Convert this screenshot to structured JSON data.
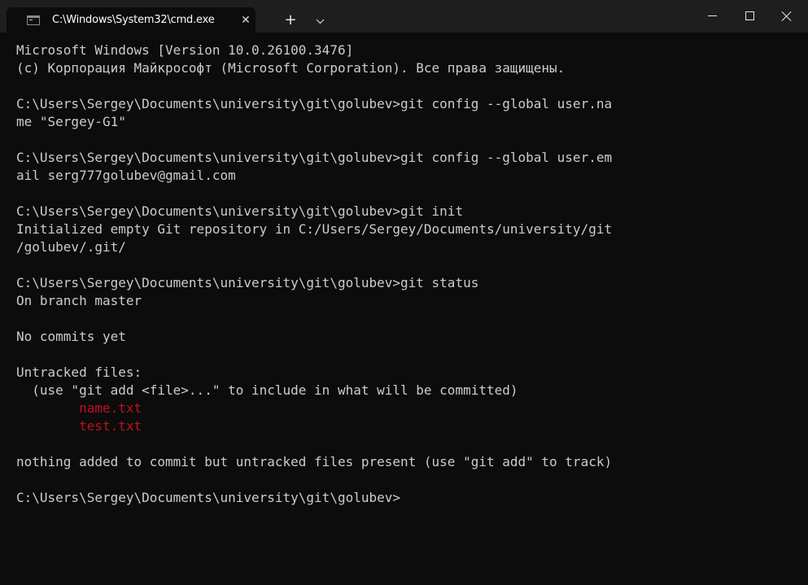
{
  "titlebar": {
    "tab_title": "C:\\Windows\\System32\\cmd.exe",
    "tab_close_icon": "close-icon",
    "new_tab_label": "+",
    "dropdown_label": "⌄",
    "minimize_icon": "minimize-icon",
    "maximize_icon": "maximize-icon",
    "close_icon": "close-icon"
  },
  "colors": {
    "background": "#0c0c0c",
    "titlebar": "#1e1e1e",
    "text": "#cccccc",
    "untracked_file": "#c50f1f"
  },
  "console": {
    "lines": [
      {
        "text": "Microsoft Windows [Version 10.0.26100.3476]",
        "kind": "normal"
      },
      {
        "text": "(c) Корпорация Майкрософт (Microsoft Corporation). Все права защищены.",
        "kind": "normal"
      },
      {
        "text": "",
        "kind": "blank"
      },
      {
        "text": "C:\\Users\\Sergey\\Documents\\university\\git\\golubev>git config --global user.na",
        "kind": "normal"
      },
      {
        "text": "me \"Sergey-G1\"",
        "kind": "normal"
      },
      {
        "text": "",
        "kind": "blank"
      },
      {
        "text": "C:\\Users\\Sergey\\Documents\\university\\git\\golubev>git config --global user.em",
        "kind": "normal"
      },
      {
        "text": "ail serg777golubev@gmail.com",
        "kind": "normal"
      },
      {
        "text": "",
        "kind": "blank"
      },
      {
        "text": "C:\\Users\\Sergey\\Documents\\university\\git\\golubev>git init",
        "kind": "normal"
      },
      {
        "text": "Initialized empty Git repository in C:/Users/Sergey/Documents/university/git",
        "kind": "normal"
      },
      {
        "text": "/golubev/.git/",
        "kind": "normal"
      },
      {
        "text": "",
        "kind": "blank"
      },
      {
        "text": "C:\\Users\\Sergey\\Documents\\university\\git\\golubev>git status",
        "kind": "normal"
      },
      {
        "text": "On branch master",
        "kind": "normal"
      },
      {
        "text": "",
        "kind": "blank"
      },
      {
        "text": "No commits yet",
        "kind": "normal"
      },
      {
        "text": "",
        "kind": "blank"
      },
      {
        "text": "Untracked files:",
        "kind": "normal"
      },
      {
        "text": "  (use \"git add <file>...\" to include in what will be committed)",
        "kind": "normal"
      },
      {
        "text": "        name.txt",
        "kind": "red"
      },
      {
        "text": "        test.txt",
        "kind": "red"
      },
      {
        "text": "",
        "kind": "blank"
      },
      {
        "text": "nothing added to commit but untracked files present (use \"git add\" to track)",
        "kind": "normal"
      },
      {
        "text": "",
        "kind": "blank"
      },
      {
        "text": "C:\\Users\\Sergey\\Documents\\university\\git\\golubev>",
        "kind": "normal"
      }
    ]
  }
}
